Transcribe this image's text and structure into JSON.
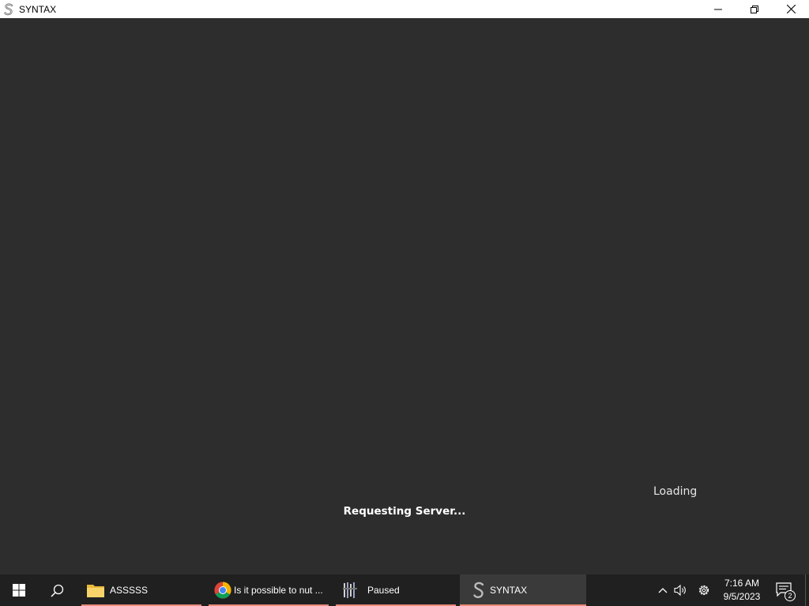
{
  "window": {
    "title": "SYNTAX",
    "icon": "syntax-s-icon",
    "controls": [
      "minimize-icon",
      "restore-icon",
      "close-icon"
    ]
  },
  "main": {
    "loading_text": "Loading",
    "status_text": "Requesting Server..."
  },
  "taskbar": {
    "start_icon": "windows-icon",
    "search_icon": "search-icon",
    "apps": [
      {
        "label": "ASSSSS",
        "icon": "folder-icon"
      },
      {
        "label": "Is it possible to nut ...",
        "icon": "chrome-icon"
      },
      {
        "label": "Paused",
        "icon": "app-icon"
      },
      {
        "label": "SYNTAX",
        "icon": "syntax-s-icon"
      }
    ],
    "tray": {
      "time": "7:16 AM",
      "date": "9/5/2023",
      "notification_count": "2"
    }
  },
  "colors": {
    "background": "#2d2d2d",
    "titlebar": "#ffffff",
    "taskbar": "#202020",
    "taskbar_active": "#3a3a3a",
    "app_underline": "#e98a78"
  }
}
